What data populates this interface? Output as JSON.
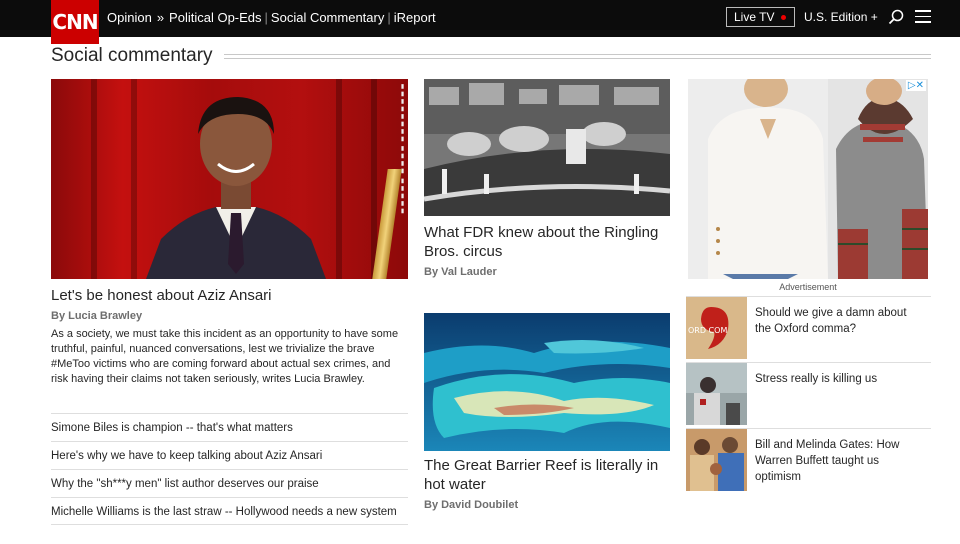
{
  "header": {
    "logo": "CNN",
    "breadcrumb": {
      "section": "Opinion",
      "arrow": "»",
      "links": [
        "Political Op-Eds",
        "Social Commentary",
        "iReport"
      ]
    },
    "live_tv": "Live TV",
    "edition": "U.S. Edition +",
    "live_color": "#e00000",
    "brand_color": "#cc0000"
  },
  "section": {
    "title": "Social commentary"
  },
  "hero": {
    "title": "Let's be honest about Aziz Ansari",
    "byline": "By Lucia Brawley",
    "description": "As a society, we must take this incident as an opportunity to have some truthful, painful, nuanced conversations, lest we trivialize the brave #MeToo victims who are coming forward about actual sex crimes, and risk having their claims not taken seriously, writes Lucia Brawley."
  },
  "list": [
    "Simone Biles is champion -- that's what matters",
    "Here's why we have to keep talking about Aziz Ansari",
    "Why the \"sh***y men\" list author deserves our praise",
    "Michelle Williams is the last straw -- Hollywood needs a new system"
  ],
  "middle": {
    "story1": {
      "title": "What FDR knew about the Ringling Bros. circus",
      "byline": "By Val Lauder"
    },
    "story2": {
      "title": "The Great Barrier Reef is literally in hot water",
      "byline": "By David Doubilet"
    }
  },
  "ad": {
    "label": "Advertisement",
    "close": "▷✕"
  },
  "sidebar": [
    {
      "title": "Should we give a damn about the Oxford comma?"
    },
    {
      "title": "Stress really is killing us"
    },
    {
      "title": "Bill and Melinda Gates: How Warren Buffett taught us optimism"
    }
  ]
}
